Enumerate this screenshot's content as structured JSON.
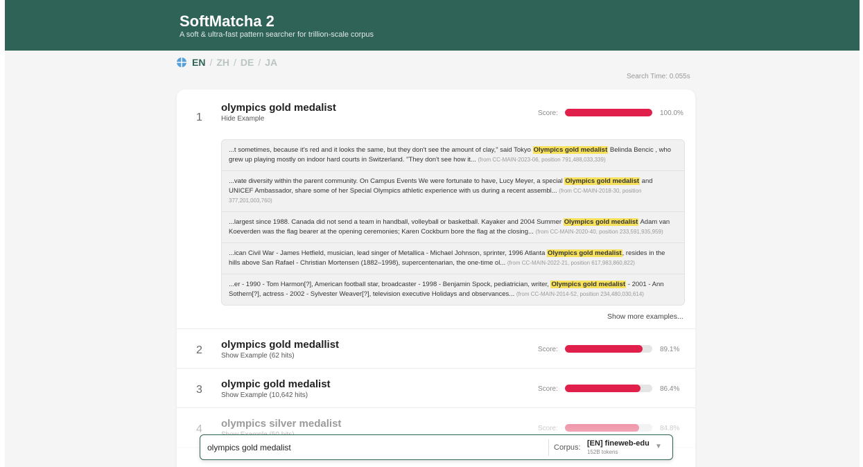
{
  "header": {
    "title": "SoftMatcha 2",
    "subtitle": "A soft & ultra-fast pattern searcher for trillion-scale corpus"
  },
  "languages": [
    "EN",
    "ZH",
    "DE",
    "JA"
  ],
  "active_language": "EN",
  "search_time": "Search Time: 0.055s",
  "score_label": "Score:",
  "results": [
    {
      "rank": "1",
      "term": "olympics gold medalist",
      "toggle": "Hide Example",
      "score": 1.0,
      "score_text": "100.0%",
      "examples": [
        {
          "before": "...t sometimes, because it's red and it looks the same, but they don't see the amount of clay,\" said Tokyo ",
          "match": "Olympics gold medalist",
          "after": " Belinda Bencic , who grew up playing mostly on indoor hard courts in Switzerland. \"They don't see how it...",
          "source": "(from CC-MAIN-2023-06, position 791,488,033,339)"
        },
        {
          "before": "...vate diversity within the parent community. On Campus Events We were fortunate to have, Lucy Meyer, a special ",
          "match": "Olympics gold medalist",
          "after": " and UNICEF Ambassador, share some of her Special Olympics athletic experience with us during a recent assembl...",
          "source": "(from CC-MAIN-2018-30, position 377,201,003,760)"
        },
        {
          "before": "...largest since 1988. Canada did not send a team in handball, volleyball or basketball. Kayaker and 2004 Summer ",
          "match": "Olympics gold medalist",
          "after": " Adam van Koeverden was the flag bearer at the opening ceremonies; Karen Cockburn bore the flag at the closing...",
          "source": "(from CC-MAIN-2020-40, position 233,591,935,959)"
        },
        {
          "before": "...ican Civil War - James Hetfield, musician, lead singer of Metallica - Michael Johnson, sprinter, 1996 Atlanta ",
          "match": "Olympics gold medalist",
          "after": ", resides in the hills above San Rafael - Christian Mortensen (1882–1998), supercentenarian, the one-time ol...",
          "source": "(from CC-MAIN-2022-21, position 617,983,860,822)"
        },
        {
          "before": "...er - 1990 - Tom Harmon[?], American football star, broadcaster - 1998 - Benjamin Spock, pediatrician, writer, ",
          "match": "Olympics gold medalist",
          "after": " - 2001 - Ann Sothern[?], actress - 2002 - Sylvester Weaver[?], television executive Holidays and observances...",
          "source": "(from CC-MAIN-2014-52, position 234,480,030,614)"
        }
      ],
      "show_more": "Show more examples..."
    },
    {
      "rank": "2",
      "term": "olympics gold medallist",
      "toggle": "Show Example (62 hits)",
      "score": 0.891,
      "score_text": "89.1%"
    },
    {
      "rank": "3",
      "term": "olympic gold medalist",
      "toggle": "Show Example (10,642 hits)",
      "score": 0.864,
      "score_text": "86.4%"
    },
    {
      "rank": "4",
      "term": "olympics silver medalist",
      "toggle": "Show Example (50 hits)",
      "score": 0.848,
      "score_text": "84.8%"
    }
  ],
  "search": {
    "query": "olympics gold medalist",
    "corpus_label": "Corpus:",
    "corpus_name": "[EN] fineweb-edu",
    "corpus_tokens": "152B tokens",
    "dropdown_icon": "chevron-down-icon"
  }
}
